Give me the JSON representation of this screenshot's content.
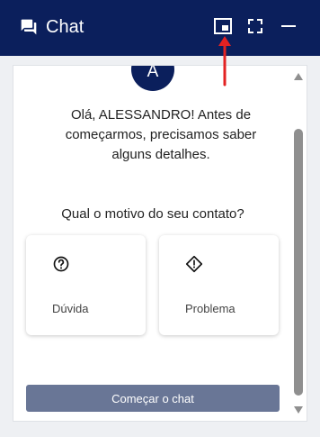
{
  "header": {
    "title": "Chat",
    "icons": {
      "chat": "chat-bubbles-icon",
      "pip": "picture-in-picture-icon",
      "fullscreen": "fullscreen-icon",
      "minimize": "minimize-icon"
    },
    "bg_color": "#0b1f5c"
  },
  "avatar": {
    "initial": "A"
  },
  "message": {
    "greeting": "Olá, ALESSANDRO! Antes de começarmos, precisamos saber alguns detalhes."
  },
  "question": "Qual o motivo do seu contato?",
  "options": [
    {
      "label": "Dúvida",
      "icon": "question-circle-icon"
    },
    {
      "label": "Problema",
      "icon": "alert-diamond-icon"
    }
  ],
  "start_button": {
    "label": "Começar o chat",
    "color": "#697696"
  },
  "annotation": {
    "arrow_color": "#e32222"
  }
}
